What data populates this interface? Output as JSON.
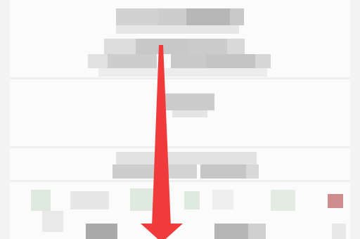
{
  "screen": {
    "note_text": "",
    "content_state": "pixelated",
    "accent_color": "#ef3b3b"
  },
  "annotation": {
    "type": "arrow",
    "direction": "down",
    "color": "#ef3b3b"
  },
  "icons": [
    "arrow-down-icon"
  ]
}
